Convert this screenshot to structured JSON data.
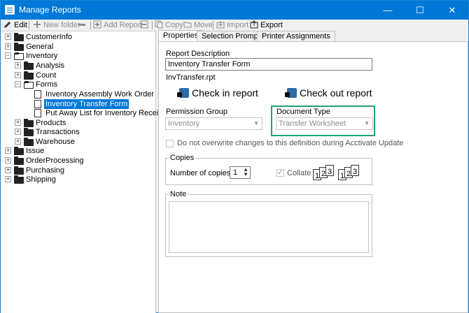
{
  "window": {
    "title": "Manage Reports"
  },
  "toolbar": {
    "edit": "Edit",
    "new_folder": "New folder",
    "add_report": "Add Report",
    "copy": "Copy",
    "move": "Move",
    "import": "Import",
    "export": "Export"
  },
  "tree": {
    "items": [
      {
        "label": "CustomerInfo"
      },
      {
        "label": "General"
      },
      {
        "label": "Inventory"
      },
      {
        "label": "Analysis"
      },
      {
        "label": "Count"
      },
      {
        "label": "Forms"
      },
      {
        "label": "Inventory Assembly Work Order"
      },
      {
        "label": "Inventory Transfer Form"
      },
      {
        "label": "Put Away List for Inventory Receipts"
      },
      {
        "label": "Products"
      },
      {
        "label": "Transactions"
      },
      {
        "label": "Warehouse"
      },
      {
        "label": "Issue"
      },
      {
        "label": "OrderProcessing"
      },
      {
        "label": "Purchasing"
      },
      {
        "label": "Shipping"
      }
    ]
  },
  "tabs": [
    {
      "label": "Properties"
    },
    {
      "label": "Selection Prompts"
    },
    {
      "label": "Printer Assignments"
    }
  ],
  "properties": {
    "report_description_label": "Report Description",
    "report_description_value": "Inventory Transfer Form",
    "filename": "InvTransfer.rpt",
    "check_in": "Check in report",
    "check_out": "Check out report",
    "permission_group_label": "Permission Group",
    "permission_group_value": "Inventory",
    "document_type_label": "Document Type",
    "document_type_value": "Transfer Worksheet",
    "no_overwrite_label": "Do not overwrite changes to this definition during Acctivate Update",
    "copies_group": "Copies",
    "number_of_copies_label": "Number of copies:",
    "number_of_copies_value": "1",
    "collate_label": "Collate",
    "note_group": "Note",
    "collate_pages": [
      "1",
      "2",
      "3"
    ]
  },
  "colors": {
    "accent": "#0078d7",
    "highlight": "#1fa37a"
  }
}
